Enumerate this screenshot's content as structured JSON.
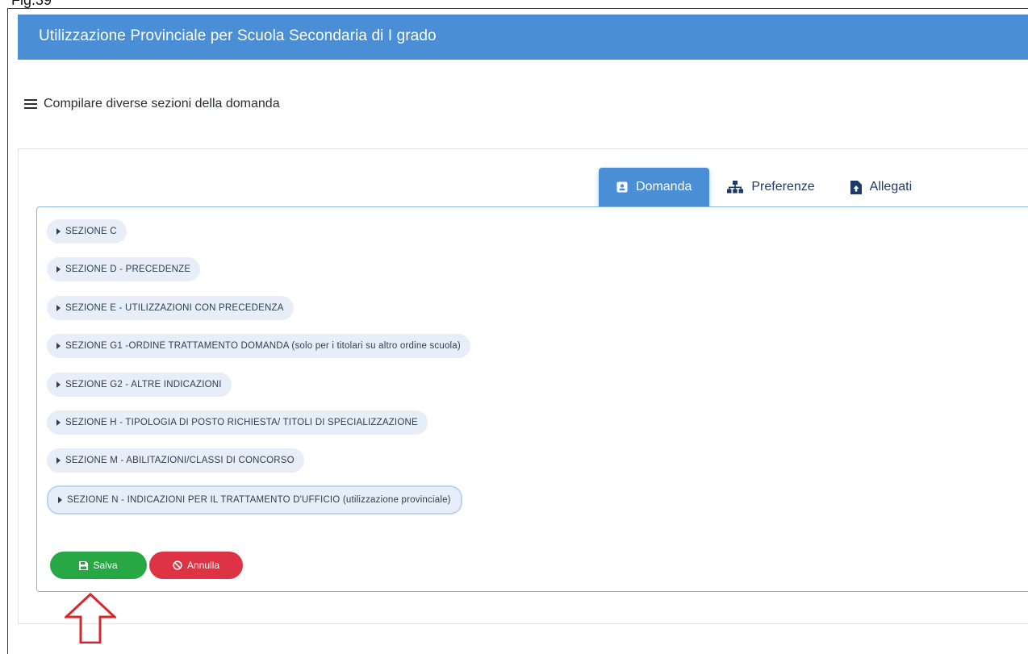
{
  "caption": "Fig.39",
  "header": {
    "title": "Utilizzazione Provinciale per Scuola Secondaria di I grado"
  },
  "subheading": {
    "text": "Compilare diverse sezioni della domanda",
    "icon": "menu-icon"
  },
  "tabs": [
    {
      "label": "Domanda",
      "icon": "user-card-icon",
      "active": true
    },
    {
      "label": "Preferenze",
      "icon": "sitemap-icon",
      "active": false
    },
    {
      "label": "Allegati",
      "icon": "file-upload-icon",
      "active": false
    }
  ],
  "sections": [
    {
      "label": "SEZIONE C"
    },
    {
      "label": "SEZIONE D - PRECEDENZE"
    },
    {
      "label": "SEZIONE E - UTILIZZAZIONI CON PRECEDENZA"
    },
    {
      "label": "SEZIONE G1 -ORDINE TRATTAMENTO DOMANDA (solo per i titolari su altro ordine scuola)"
    },
    {
      "label": "SEZIONE G2 - ALTRE INDICAZIONI"
    },
    {
      "label": "SEZIONE H - TIPOLOGIA DI POSTO RICHIESTA/ TITOLI DI SPECIALIZZAZIONE"
    },
    {
      "label": "SEZIONE M - ABILITAZIONI/CLASSI DI CONCORSO"
    },
    {
      "label": "SEZIONE N - INDICAZIONI PER IL TRATTAMENTO D'UFFICIO (utilizzazione provinciale)"
    }
  ],
  "buttons": {
    "save_label": "Salva",
    "cancel_label": "Annulla"
  },
  "colors": {
    "header": "#4a8fd6",
    "save": "#27a844",
    "cancel": "#dd3344",
    "section_bg": "#e7eef7",
    "annotation_arrow": "#d9262b"
  }
}
